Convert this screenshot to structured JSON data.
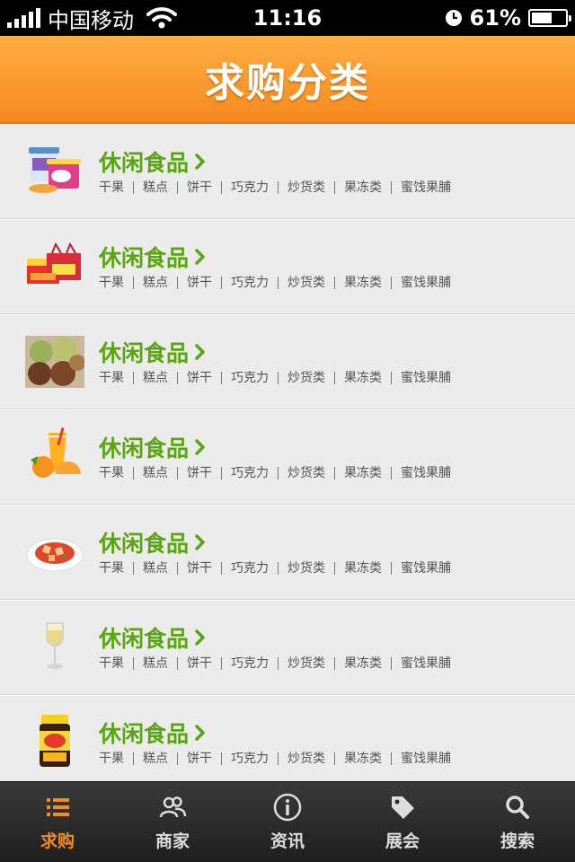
{
  "status_bar": {
    "carrier": "中国移动",
    "time": "11:16",
    "battery_percent": "61%",
    "battery_level": 0.61
  },
  "header": {
    "title": "求购分类"
  },
  "categories": [
    {
      "title": "休闲食品",
      "icon": "snack-cups-image",
      "tags": [
        "干果",
        "糕点",
        "饼干",
        "巧克力",
        "炒货类",
        "果冻类",
        "蜜饯果脯"
      ]
    },
    {
      "title": "休闲食品",
      "icon": "gift-boxes-image",
      "tags": [
        "干果",
        "糕点",
        "饼干",
        "巧克力",
        "炒货类",
        "果冻类",
        "蜜饯果脯"
      ]
    },
    {
      "title": "休闲食品",
      "icon": "pastries-image",
      "tags": [
        "干果",
        "糕点",
        "饼干",
        "巧克力",
        "炒货类",
        "果冻类",
        "蜜饯果脯"
      ]
    },
    {
      "title": "休闲食品",
      "icon": "orange-juice-image",
      "tags": [
        "干果",
        "糕点",
        "饼干",
        "巧克力",
        "炒货类",
        "果冻类",
        "蜜饯果脯"
      ]
    },
    {
      "title": "休闲食品",
      "icon": "dish-image",
      "tags": [
        "干果",
        "糕点",
        "饼干",
        "巧克力",
        "炒货类",
        "果冻类",
        "蜜饯果脯"
      ]
    },
    {
      "title": "休闲食品",
      "icon": "wine-glass-image",
      "tags": [
        "干果",
        "糕点",
        "饼干",
        "巧克力",
        "炒货类",
        "果冻类",
        "蜜饯果脯"
      ]
    },
    {
      "title": "休闲食品",
      "icon": "sauce-jar-image",
      "tags": [
        "干果",
        "糕点",
        "饼干",
        "巧克力",
        "炒货类",
        "果冻类",
        "蜜饯果脯"
      ]
    }
  ],
  "tabbar": {
    "tabs": [
      {
        "label": "求购",
        "icon": "list-icon",
        "active": true
      },
      {
        "label": "商家",
        "icon": "users-icon",
        "active": false
      },
      {
        "label": "资讯",
        "icon": "info-icon",
        "active": false
      },
      {
        "label": "展会",
        "icon": "tag-icon",
        "active": false
      },
      {
        "label": "搜索",
        "icon": "search-icon",
        "active": false
      }
    ]
  },
  "colors": {
    "header_orange": "#f58a1f",
    "title_green": "#5aa512",
    "tab_active": "#f58a1f"
  }
}
